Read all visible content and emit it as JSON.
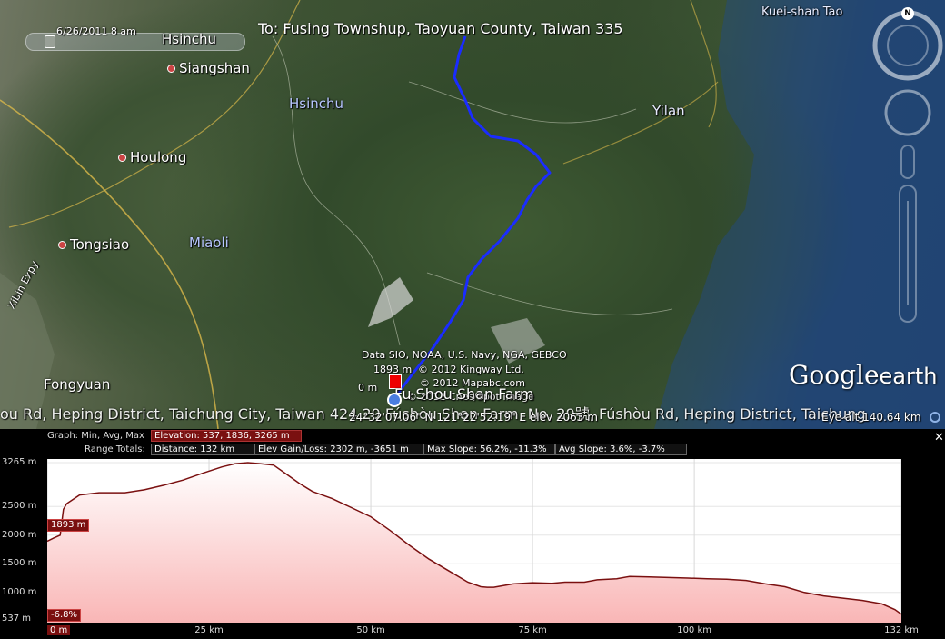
{
  "map": {
    "timestamp": "6/26/2011   8 am",
    "destination": "To: Fusing Townshup, Taoyuan County, Taiwan 335",
    "places": [
      {
        "name": "Kuei-shan Tao",
        "kind": "place"
      },
      {
        "name": "Hsinchu",
        "kind": "place"
      },
      {
        "name": "Siangshan",
        "kind": "place"
      },
      {
        "name": "Hsinchu",
        "kind": "region"
      },
      {
        "name": "Yilan",
        "kind": "region"
      },
      {
        "name": "Houlong",
        "kind": "place"
      },
      {
        "name": "Tongsiao",
        "kind": "place"
      },
      {
        "name": "Miaoli",
        "kind": "region"
      },
      {
        "name": "Fongyuan",
        "kind": "place"
      },
      {
        "name": "Xibin Expy",
        "kind": "road"
      }
    ],
    "attribution": [
      "Data SIO, NOAA, U.S. Navy, NGA, GEBCO",
      "© 2012 Kingway Ltd.",
      "© 2012 Mapabc.com",
      "© 2012 Cnes/Spot Image"
    ],
    "marker_elevation": "1893 m",
    "zero_label": "0 m",
    "farm_label": "Fu Shou Shan Farm",
    "address_line": "ou Rd, Heping District, Taichung City, Taiwan 424   29 Fúshòu Shan Farm, No. 29號, Fúshòu Rd, Heping District, Taichung",
    "coords": "24°32'07.06\" N  121°22'52.19\" E  elev  2063 m",
    "eye_alt": "Eye alt  140.64 km",
    "logo_google": "Google",
    "logo_earth": "earth",
    "compass_letter": "N"
  },
  "profile": {
    "graph_label": "Graph: Min, Avg, Max",
    "elevation_stat": "Elevation: 537, 1836, 3265 m",
    "range_label": "Range Totals:",
    "distance": "Distance: 132 km",
    "elev_gain": "Elev Gain/Loss: 2302 m, -3651 m",
    "max_slope": "Max Slope: 56.2%, -11.3%",
    "avg_slope": "Avg Slope: 3.6%, -3.7%",
    "cursor_elev": "1893 m",
    "cursor_slope": "-6.8%",
    "close_label": "✕",
    "colors": {
      "fill": "#f9b6b6",
      "line": "#7a1010",
      "route": "#1a2cff"
    }
  },
  "chart_data": {
    "type": "area",
    "title": "",
    "xlabel": "",
    "ylabel": "",
    "x_unit": "km",
    "y_unit": "m",
    "xlim": [
      0,
      132
    ],
    "ylim": [
      537,
      3265
    ],
    "y_ticks": [
      "3265 m",
      "2500 m",
      "2000 m",
      "1500 m",
      "1000 m",
      "537 m"
    ],
    "y_tick_values": [
      3265,
      2500,
      2000,
      1500,
      1000,
      537
    ],
    "x_ticks": [
      "0 m",
      "25 km",
      "50 km",
      "75 km",
      "100 km",
      "132 km"
    ],
    "x_tick_values": [
      0,
      25,
      50,
      75,
      100,
      132
    ],
    "grid": true,
    "series": [
      {
        "x": [
          0,
          1,
          2,
          2.5,
          3,
          5,
          8,
          12,
          15,
          18,
          21,
          24,
          27,
          29,
          31,
          33,
          35,
          37,
          39,
          41,
          44,
          47,
          50,
          53,
          56,
          59,
          62,
          65,
          67,
          68,
          69,
          70,
          72,
          75,
          78,
          80,
          83,
          85,
          88,
          90,
          93,
          96,
          99,
          102,
          105,
          108,
          111,
          114,
          117,
          120,
          123,
          126,
          129,
          131,
          132
        ],
        "y": [
          1893,
          1950,
          2000,
          2450,
          2550,
          2700,
          2740,
          2740,
          2790,
          2870,
          2960,
          3080,
          3190,
          3245,
          3265,
          3245,
          3220,
          3060,
          2900,
          2760,
          2640,
          2480,
          2320,
          2080,
          1820,
          1580,
          1380,
          1180,
          1100,
          1090,
          1090,
          1110,
          1150,
          1170,
          1160,
          1180,
          1180,
          1220,
          1240,
          1280,
          1270,
          1260,
          1250,
          1240,
          1230,
          1210,
          1150,
          1100,
          1000,
          940,
          900,
          860,
          800,
          700,
          620
        ]
      }
    ]
  }
}
